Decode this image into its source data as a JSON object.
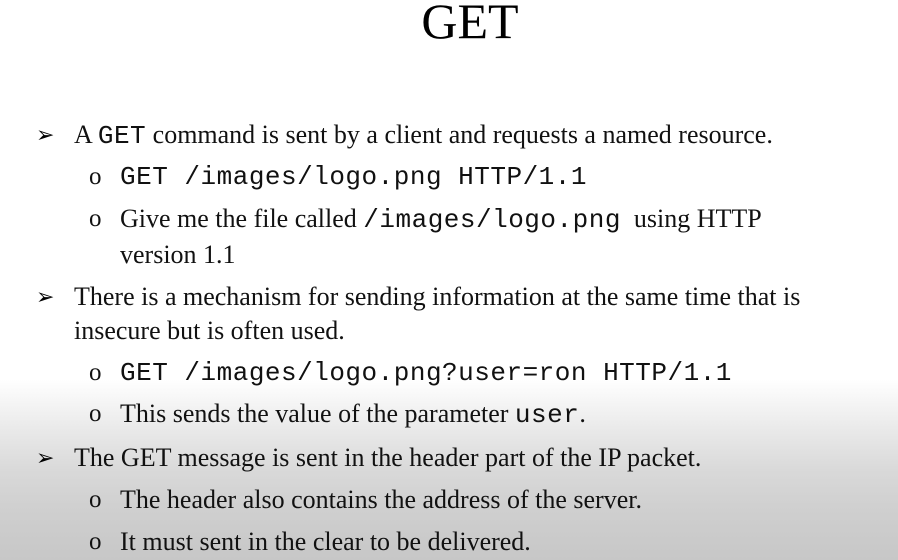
{
  "title": "GET",
  "bullets": [
    {
      "marker": "➢",
      "lines": [
        {
          "parts": [
            "A ",
            "GET",
            " command is sent by a client and requests a named resource."
          ]
        }
      ],
      "subs": [
        {
          "marker": "o",
          "lines": [
            {
              "code": "GET /images/logo.png HTTP/1.1"
            }
          ]
        },
        {
          "marker": "o",
          "lines": [
            {
              "parts": [
                "Give me the file called ",
                "/images/logo.png",
                "  using HTTP"
              ]
            },
            {
              "text": "version 1.1"
            }
          ]
        }
      ]
    },
    {
      "marker": "➢",
      "lines": [
        {
          "text": "There is a mechanism for sending information at the same time that is"
        },
        {
          "text": "insecure but is often used."
        }
      ],
      "subs": [
        {
          "marker": "o",
          "lines": [
            {
              "code": "GET /images/logo.png?user=ron HTTP/1.1"
            }
          ]
        },
        {
          "marker": "o",
          "lines": [
            {
              "parts": [
                "This sends the value of the parameter ",
                "user",
                "."
              ]
            }
          ]
        }
      ]
    },
    {
      "marker": "➢",
      "lines": [
        {
          "text": "The GET message is sent in the header part of the IP packet."
        }
      ],
      "subs": [
        {
          "marker": "o",
          "lines": [
            {
              "text": "The header also contains the address of the server."
            }
          ]
        },
        {
          "marker": "o",
          "lines": [
            {
              "text": "It must sent in the clear to be delivered."
            }
          ]
        }
      ]
    }
  ]
}
